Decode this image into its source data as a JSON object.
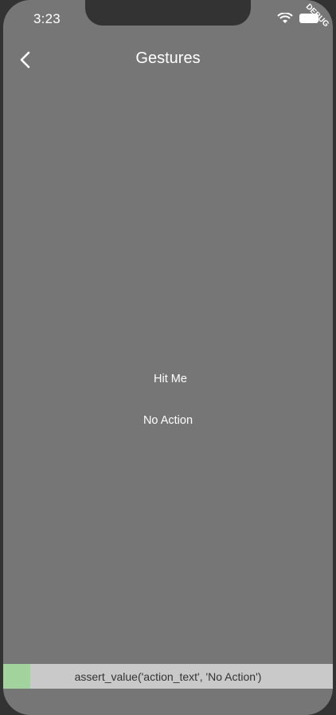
{
  "status_bar": {
    "time": "3:23",
    "debug_label": "DEBUG"
  },
  "app_bar": {
    "title": "Gestures",
    "back_icon": "chevron-left-icon"
  },
  "main": {
    "hit_label": "Hit Me",
    "action_text": "No Action"
  },
  "assert_bar": {
    "text": "assert_value('action_text', 'No Action')",
    "status_color": "#a3d39c"
  }
}
